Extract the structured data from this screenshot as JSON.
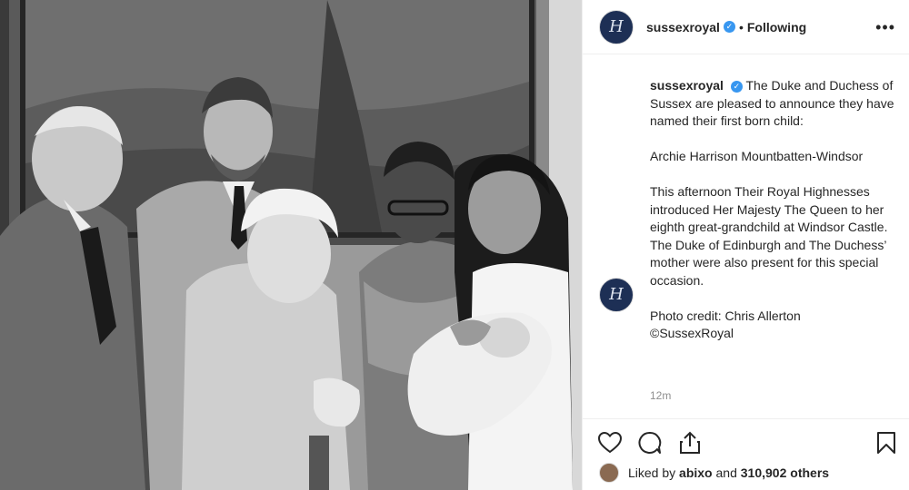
{
  "post": {
    "username": "sussexroyal",
    "separator": "•",
    "follow_status": "Following",
    "more_icon": "ellipsis-icon",
    "avatar_monogram": "H",
    "caption": {
      "username": "sussexroyal",
      "line1": "The Duke and Duchess of Sussex are pleased to announce they have named their first born child:",
      "line2": "Archie Harrison Mountbatten-Windsor",
      "line3": "This afternoon Their Royal Highnesses introduced Her Majesty The Queen to her eighth great-grandchild at Windsor Castle. The Duke of Edinburgh and The Duchess’ mother were also present for this special occasion.",
      "line4a": "Photo credit: Chris Allerton",
      "line4b": "©SussexRoyal"
    },
    "time": "12m",
    "likes": {
      "prefix": "Liked by ",
      "user": "abixo",
      "mid": " and ",
      "count": "310,902 others"
    }
  },
  "icons": {
    "like": "heart-icon",
    "comment": "comment-icon",
    "share": "share-icon",
    "save": "bookmark-icon",
    "verified": "verified-badge-icon"
  },
  "colors": {
    "verified": "#3897f0",
    "border": "#efefef",
    "muted": "#8e8e8e",
    "avatar_bg": "#1d2f55"
  }
}
